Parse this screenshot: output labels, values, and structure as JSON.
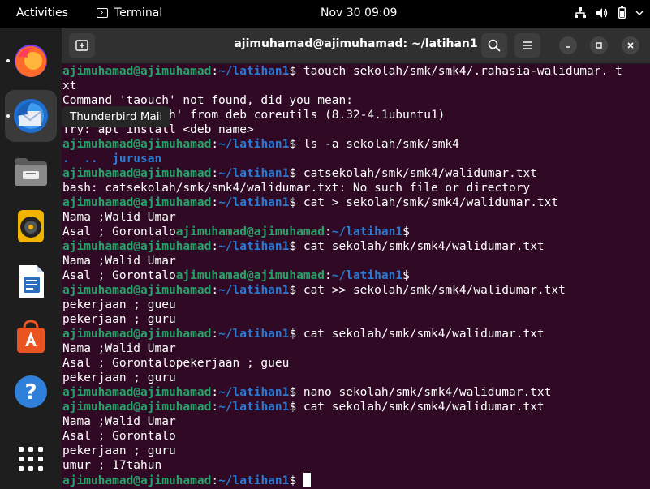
{
  "topbar": {
    "activities": "Activities",
    "app_name": "Terminal",
    "clock": "Nov 30  09:09",
    "icons": [
      "network-icon",
      "volume-icon",
      "battery-icon"
    ]
  },
  "dock": {
    "items": [
      "firefox",
      "thunderbird-mail",
      "files",
      "rhythmbox",
      "libreoffice-writer",
      "ubuntu-software",
      "help",
      "show-applications"
    ],
    "tooltip": "Thunderbird Mail"
  },
  "window": {
    "title": "ajimuhamad@ajimuhamad: ~/latihan1",
    "new_tab_icon": "new-tab-icon",
    "search_icon": "search-icon",
    "menu_icon": "hamburger-menu-icon"
  },
  "prompt": {
    "user": "ajimuhamad@ajimuhamad",
    "sep": ":",
    "path": "~/latihan1",
    "dollar": "$"
  },
  "terminal_lines": [
    {
      "type": "cmd",
      "cmd": " taouch sekolah/smk/smk4/.rahasia-walidumar. t"
    },
    {
      "type": "out",
      "text": "xt"
    },
    {
      "type": "out",
      "text": "Command 'taouch' not found, did you mean:"
    },
    {
      "type": "out",
      "text": "  command 'touch' from deb coreutils (8.32-4.1ubuntu1)"
    },
    {
      "type": "out",
      "text": "Try: apt install <deb name>"
    },
    {
      "type": "cmd",
      "cmd": " ls -a sekolah/smk/smk4"
    },
    {
      "type": "dir",
      "text": ".  ..  jurusan"
    },
    {
      "type": "cmd",
      "cmd": " catsekolah/smk/smk4/walidumar.txt"
    },
    {
      "type": "out",
      "text": "bash: catsekolah/smk/smk4/walidumar.txt: No such file or directory"
    },
    {
      "type": "cmd",
      "cmd": " cat > sekolah/smk/smk4/walidumar.txt"
    },
    {
      "type": "out",
      "text": "Nama ;Walid Umar"
    },
    {
      "type": "mixed",
      "text": "Asal ; Gorontalo"
    },
    {
      "type": "cmd",
      "cmd": " cat sekolah/smk/smk4/walidumar.txt"
    },
    {
      "type": "out",
      "text": "Nama ;Walid Umar"
    },
    {
      "type": "mixed",
      "text": "Asal ; Gorontalo"
    },
    {
      "type": "cmd",
      "cmd": " cat >> sekolah/smk/smk4/walidumar.txt"
    },
    {
      "type": "out",
      "text": "pekerjaan ; gueu"
    },
    {
      "type": "out",
      "text": "pekerjaan ; guru"
    },
    {
      "type": "cmd",
      "cmd": " cat sekolah/smk/smk4/walidumar.txt"
    },
    {
      "type": "out",
      "text": "Nama ;Walid Umar"
    },
    {
      "type": "out",
      "text": "Asal ; Gorontalopekerjaan ; gueu"
    },
    {
      "type": "out",
      "text": "pekerjaan ; guru"
    },
    {
      "type": "cmd",
      "cmd": " nano sekolah/smk/smk4/walidumar.txt"
    },
    {
      "type": "cmd",
      "cmd": " cat sekolah/smk/smk4/walidumar.txt"
    },
    {
      "type": "out",
      "text": "Nama ;Walid Umar"
    },
    {
      "type": "out",
      "text": "Asal ; Gorontalo"
    },
    {
      "type": "out",
      "text": "pekerjaan ; guru"
    },
    {
      "type": "out",
      "text": "umur ; 17tahun"
    },
    {
      "type": "cmd",
      "cmd": " ",
      "cursor": true
    }
  ],
  "colors": {
    "terminal_bg": "#300a24",
    "prompt_user": "#26a269",
    "prompt_path": "#2a7bd4",
    "titlebar": "#303030"
  }
}
